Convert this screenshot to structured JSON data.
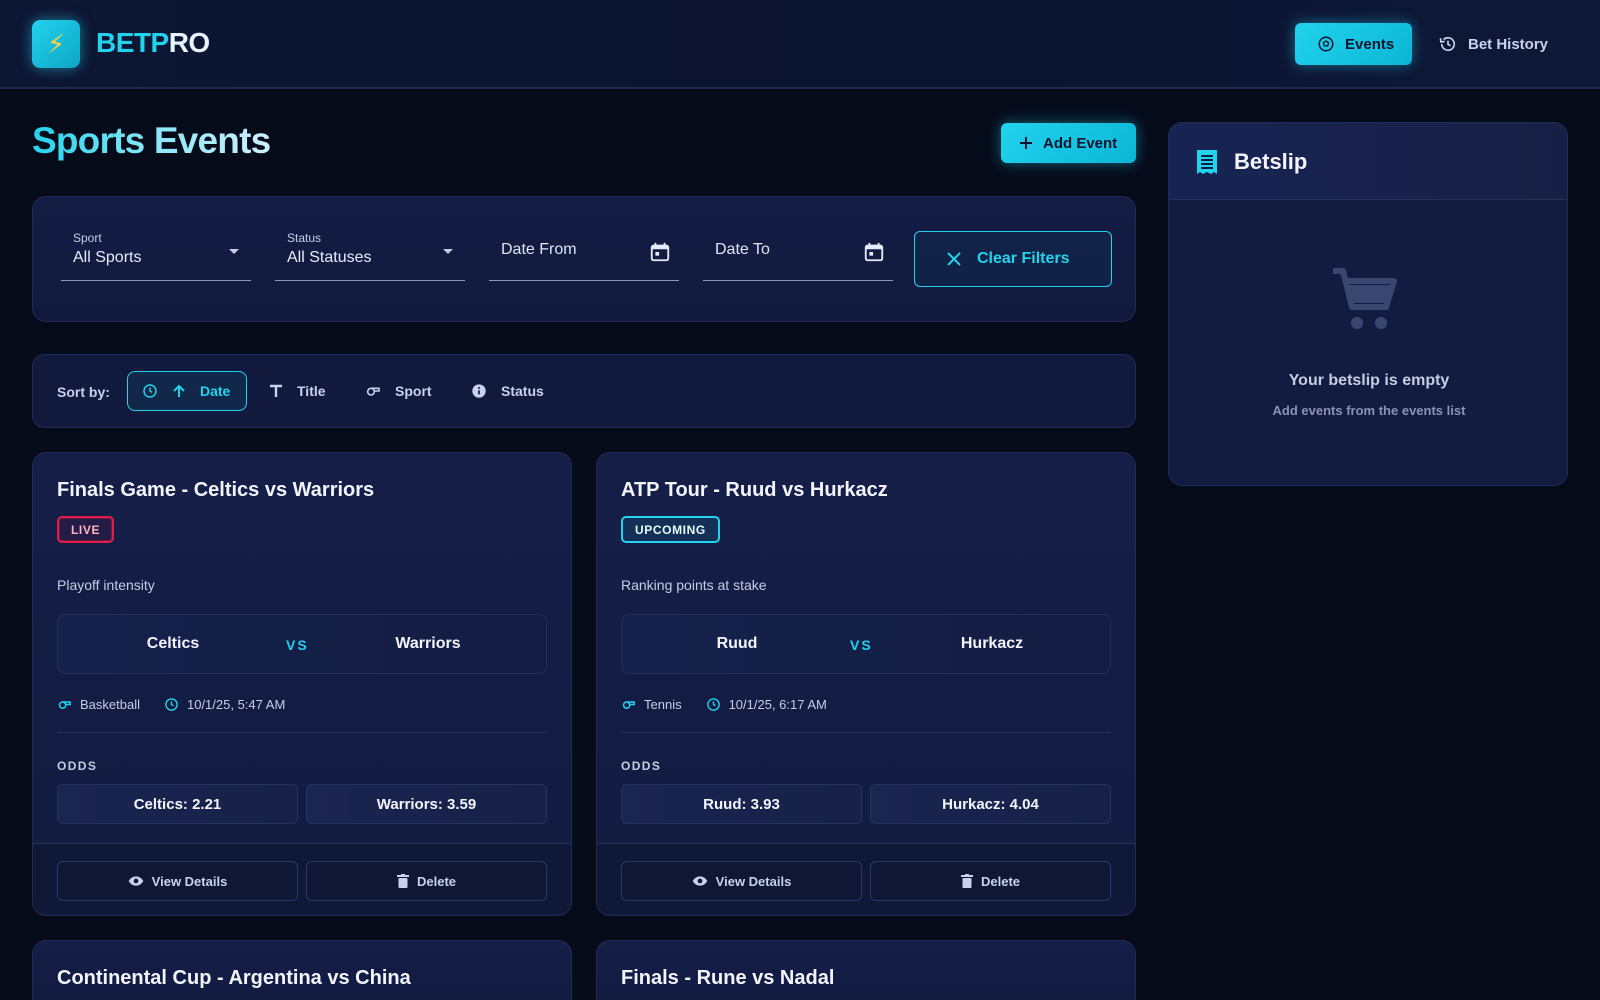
{
  "header": {
    "logo_glyph": "⚡",
    "brand_part1": "BETP",
    "brand_part2": "RO",
    "nav": {
      "events_label": "Events",
      "history_label": "Bet History"
    }
  },
  "page": {
    "title": "Sports Events",
    "add_event_label": "Add Event"
  },
  "filters": {
    "sport": {
      "label": "Sport",
      "value": "All Sports"
    },
    "status": {
      "label": "Status",
      "value": "All Statuses"
    },
    "date_from": {
      "placeholder": "Date From"
    },
    "date_to": {
      "placeholder": "Date To"
    },
    "clear_label": "Clear Filters"
  },
  "sort": {
    "label": "Sort by:",
    "options": [
      {
        "label": "Date",
        "active": true
      },
      {
        "label": "Title",
        "active": false
      },
      {
        "label": "Sport",
        "active": false
      },
      {
        "label": "Status",
        "active": false
      }
    ]
  },
  "events": [
    {
      "title": "Finals Game - Celtics vs Warriors",
      "status": "LIVE",
      "description": "Playoff intensity",
      "team1": "Celtics",
      "team2": "Warriors",
      "vs": "VS",
      "sport": "Basketball",
      "datetime": "10/1/25, 5:47 AM",
      "odds_label": "ODDS",
      "odds": [
        "Celtics: 2.21",
        "Warriors: 3.59"
      ],
      "view_label": "View Details",
      "delete_label": "Delete"
    },
    {
      "title": "ATP Tour - Ruud vs Hurkacz",
      "status": "UPCOMING",
      "description": "Ranking points at stake",
      "team1": "Ruud",
      "team2": "Hurkacz",
      "vs": "VS",
      "sport": "Tennis",
      "datetime": "10/1/25, 6:17 AM",
      "odds_label": "ODDS",
      "odds": [
        "Ruud: 3.93",
        "Hurkacz: 4.04"
      ],
      "view_label": "View Details",
      "delete_label": "Delete"
    },
    {
      "title": "Continental Cup - Argentina vs China"
    },
    {
      "title": "Finals - Rune vs Nadal"
    }
  ],
  "betslip": {
    "title": "Betslip",
    "empty_title": "Your betslip is empty",
    "empty_subtitle": "Add events from the events list"
  },
  "colors": {
    "accent": "#22d3ee",
    "background": "#060b1a",
    "live": "#e11d48"
  }
}
